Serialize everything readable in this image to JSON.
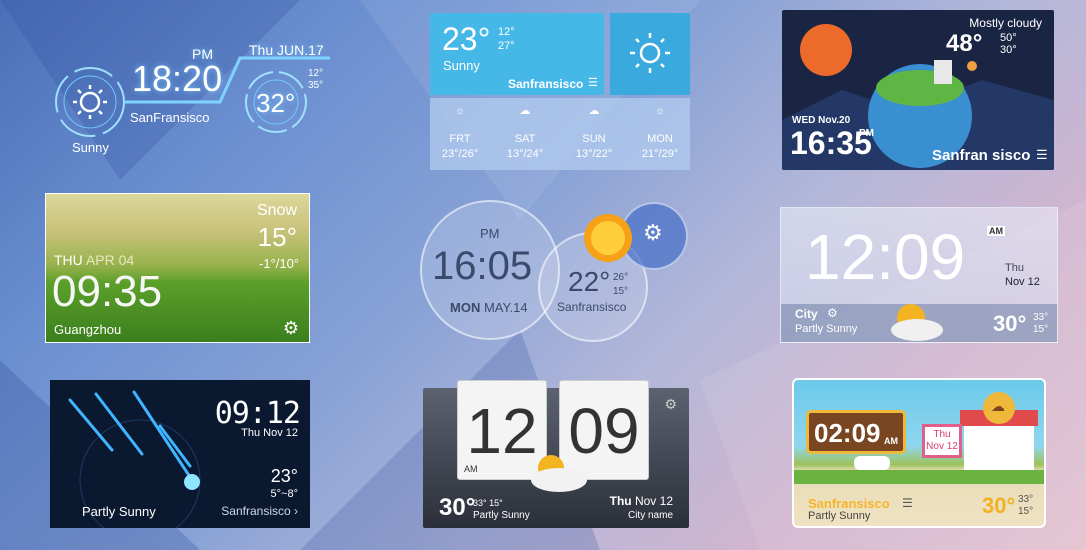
{
  "widgets": {
    "hud": {
      "pm": "PM",
      "time": "18:20",
      "date": "Thu JUN.17",
      "city": "SanFransisco",
      "condition": "Sunny",
      "temp": "32°",
      "high": "12°",
      "low": "35°"
    },
    "flat": {
      "temp": "23°",
      "high": "12°",
      "low": "27°",
      "condition": "Sunny",
      "city": "Sanfransisco",
      "forecast": [
        {
          "day": "FRT",
          "range": "23°/26°",
          "icon": "sun-icon"
        },
        {
          "day": "SAT",
          "range": "13°/24°",
          "icon": "partly-cloudy-icon"
        },
        {
          "day": "SUN",
          "range": "13°/22°",
          "icon": "partly-cloudy-icon"
        },
        {
          "day": "MON",
          "range": "21°/29°",
          "icon": "sun-icon"
        }
      ]
    },
    "planet": {
      "condition": "Mostly cloudy",
      "temp": "48°",
      "high": "50°",
      "low": "30°",
      "date": "WED Nov.20",
      "time": "16:35",
      "pm": "PM",
      "city": "Sanfran sisco"
    },
    "field": {
      "condition": "Snow",
      "temp": "15°",
      "range": "-1°/10°",
      "day": "THU",
      "date": "APR 04",
      "time": "09:35",
      "city": "Guangzhou"
    },
    "bubbles": {
      "pm": "PM",
      "time": "16:05",
      "day": "MON",
      "date": "MAY.14",
      "temp": "22°",
      "high": "26°",
      "low": "15°",
      "city": "Sanfransisco"
    },
    "glass": {
      "time": "12:09",
      "am": "AM",
      "day": "Thu",
      "date": "Nov 12",
      "city": "City",
      "condition": "Partly Sunny",
      "temp": "30°",
      "high": "33°",
      "low": "15°"
    },
    "meteor": {
      "time": "09:12",
      "date": "Thu   Nov 12",
      "temp": "23°",
      "range": "5°~8°",
      "condition": "Partly Sunny",
      "city": "Sanfransisco ›"
    },
    "flip": {
      "hour": "12",
      "minute": "09",
      "am": "AM",
      "temp": "30°",
      "high": "33°",
      "low": "15°",
      "condition": "Partly Sunny",
      "day": "Thu",
      "date": "Nov 12",
      "city": "City name"
    },
    "cartoon": {
      "time": "02:09",
      "am": "AM",
      "day": "Thu",
      "date": "Nov 12",
      "city": "Sanfransisco",
      "condition": "Partly Sunny",
      "temp": "30°",
      "high": "33°",
      "low": "15°"
    }
  }
}
